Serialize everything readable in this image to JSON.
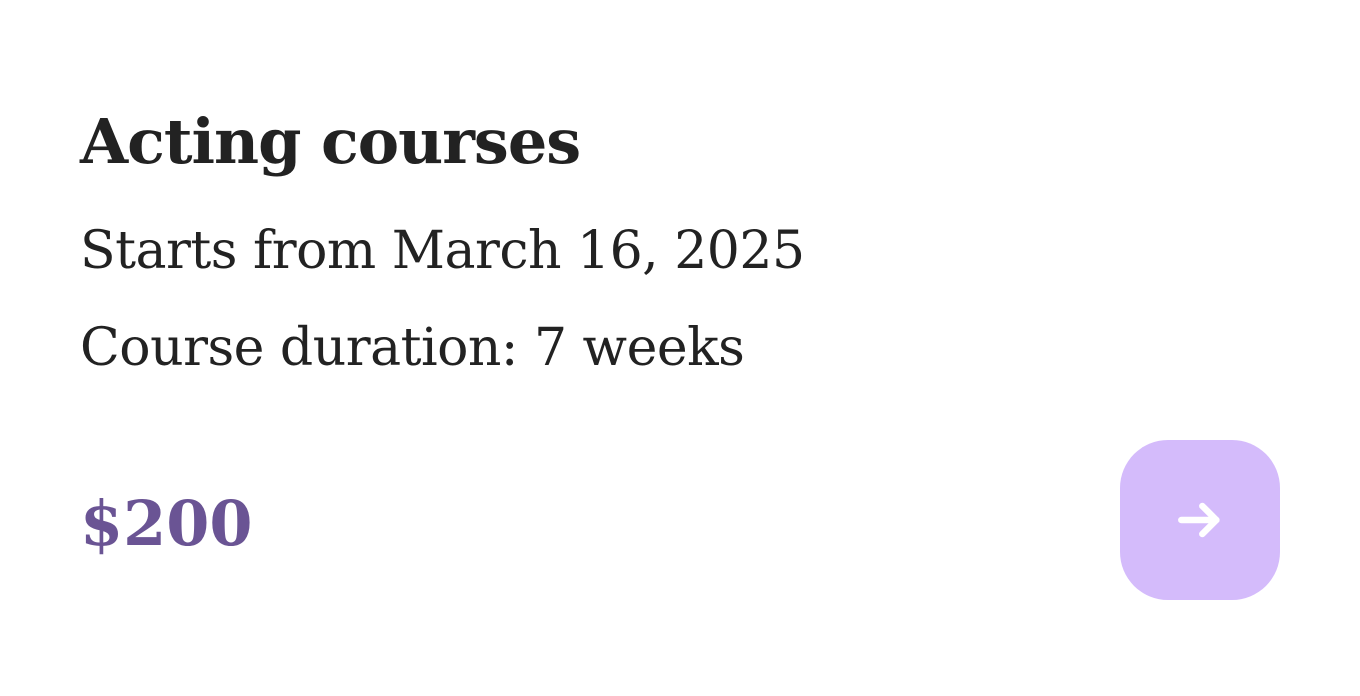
{
  "course": {
    "title": "Acting courses",
    "start_text": "Starts from March 16, 2025",
    "duration_text": "Course duration: 7 weeks",
    "price": "$200"
  },
  "action_button": {
    "icon": "arrow-right-icon"
  },
  "colors": {
    "text": "#222222",
    "price": "#6a5494",
    "button_bg": "#d4bbfb",
    "button_icon": "#ffffff"
  }
}
